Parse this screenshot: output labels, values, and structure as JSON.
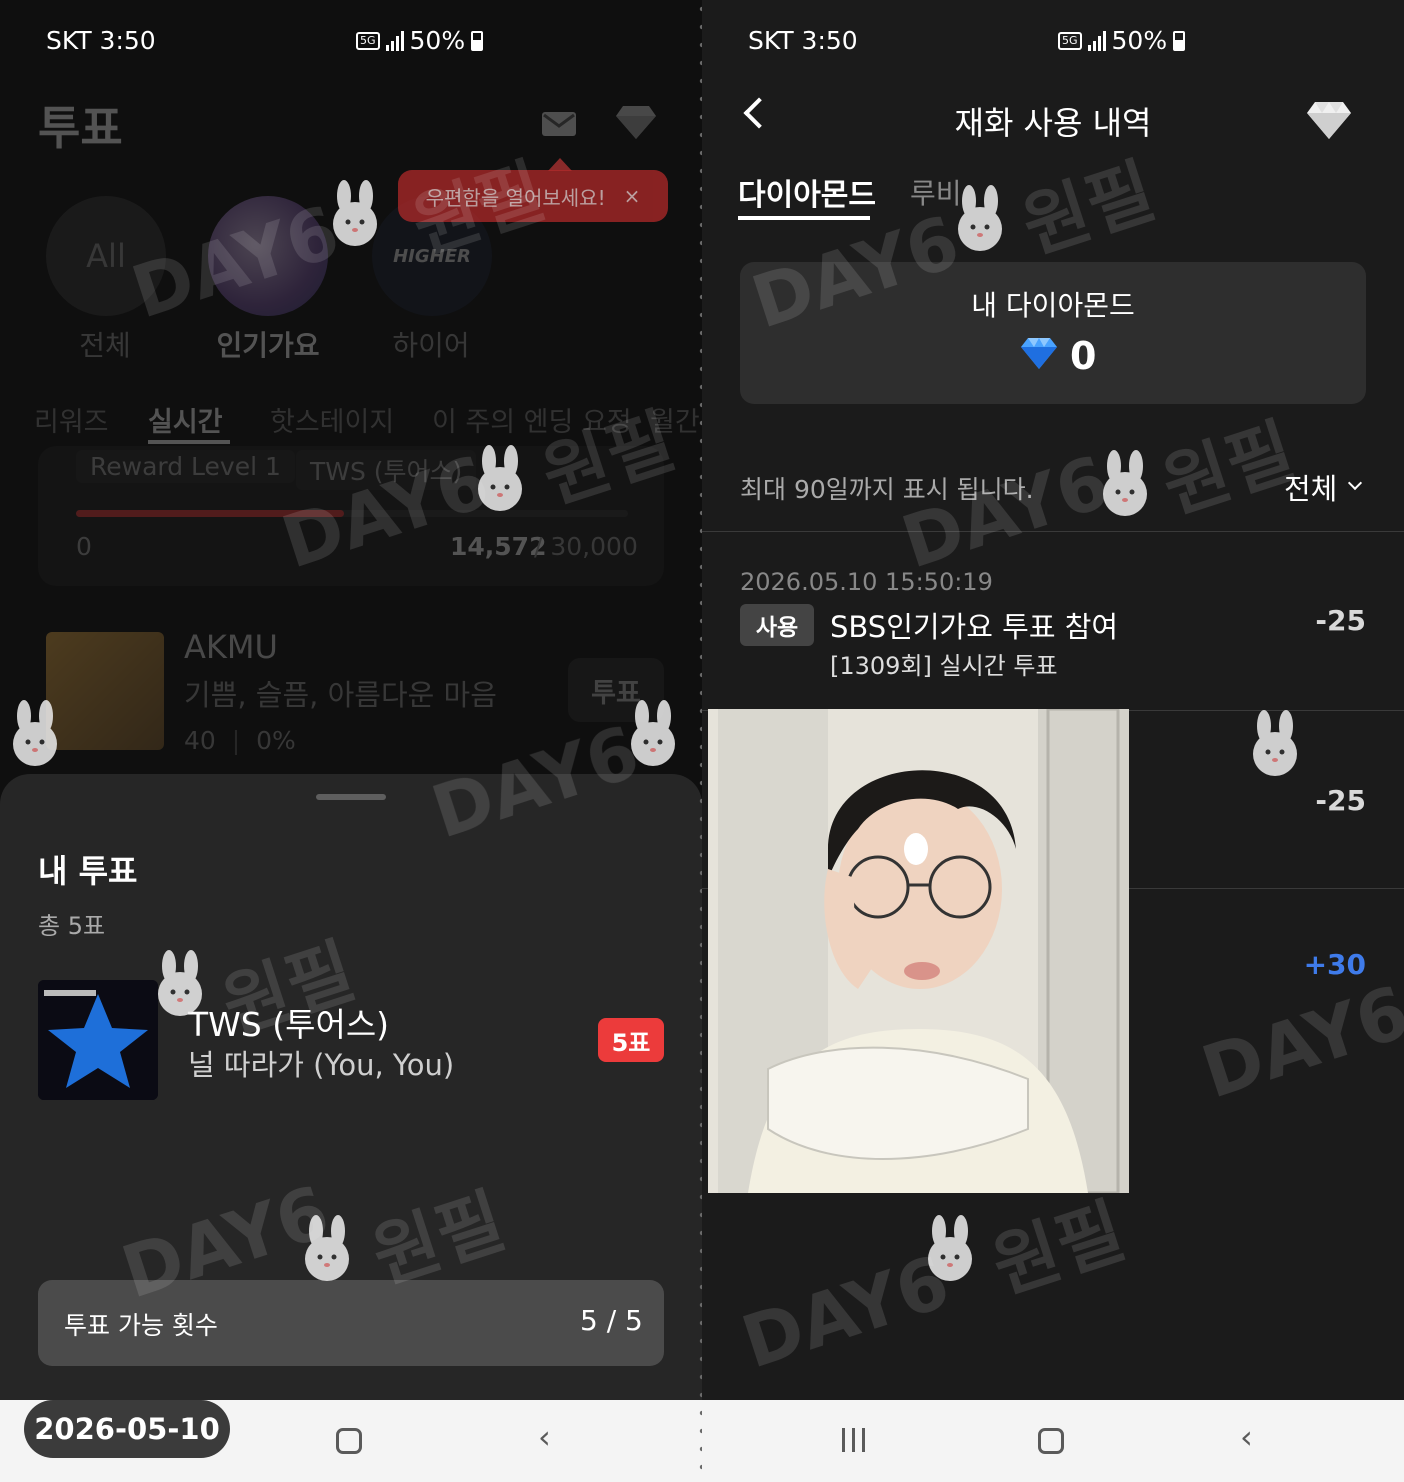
{
  "left": {
    "status": {
      "carrier_time": "SKT 3:50",
      "network": "5G",
      "battery": "50%"
    },
    "header": {
      "title": "투표",
      "tooltip": "우편함을 열어보세요!",
      "tooltip_close": "×"
    },
    "categories": [
      {
        "label": "전체",
        "circle_text": "All"
      },
      {
        "label": "인기가요",
        "circle_text": ""
      },
      {
        "label": "하이어",
        "circle_text": "HIGHER"
      }
    ],
    "tabs": [
      "리워즈",
      "실시간",
      "핫스테이지",
      "이 주의 엔딩 요정",
      "월간"
    ],
    "active_tab": "실시간",
    "reward": {
      "level": "Reward Level 1",
      "artist": "TWS (투어스)",
      "min": "0",
      "current": "14,572",
      "max": "/ 30,000",
      "progress": 0.4857
    },
    "candidate": {
      "artist": "AKMU",
      "song": "기쁨, 슬픔, 아름다운 마음",
      "votes": "40",
      "percent": "0%",
      "vote_button": "투표"
    },
    "sheet": {
      "title": "내 투표",
      "total": "총 5표",
      "vote": {
        "artist": "TWS (투어스)",
        "song": "널 따라가 (You, You)",
        "count": "5표"
      },
      "available_label": "투표 가능 횟수",
      "available_count": "5 / 5"
    },
    "date_pill": "2026-05-10"
  },
  "right": {
    "status": {
      "carrier_time": "SKT 3:50",
      "network": "5G",
      "battery": "50%"
    },
    "header": {
      "title": "재화 사용 내역"
    },
    "tabs": [
      "다이아몬드",
      "루비"
    ],
    "wallet": {
      "label": "내 다이아몬드",
      "amount": "0"
    },
    "notice": "최대 90일까지 표시 됩니다.",
    "filter": "전체",
    "transactions": [
      {
        "date": "2026.05.10 15:50:19",
        "tag": "사용",
        "title": "SBS인기가요 투표 참여",
        "subtitle": "[1309회] 실시간 투표",
        "amount": "-25"
      },
      {
        "amount": "-25"
      },
      {
        "amount": "+30"
      }
    ]
  },
  "watermark": {
    "text1": "DAY6",
    "text2": "원필"
  },
  "colors": {
    "accent_red": "#ec3b3b",
    "progress_red": "#d83838",
    "plus_blue": "#3f7bea"
  }
}
